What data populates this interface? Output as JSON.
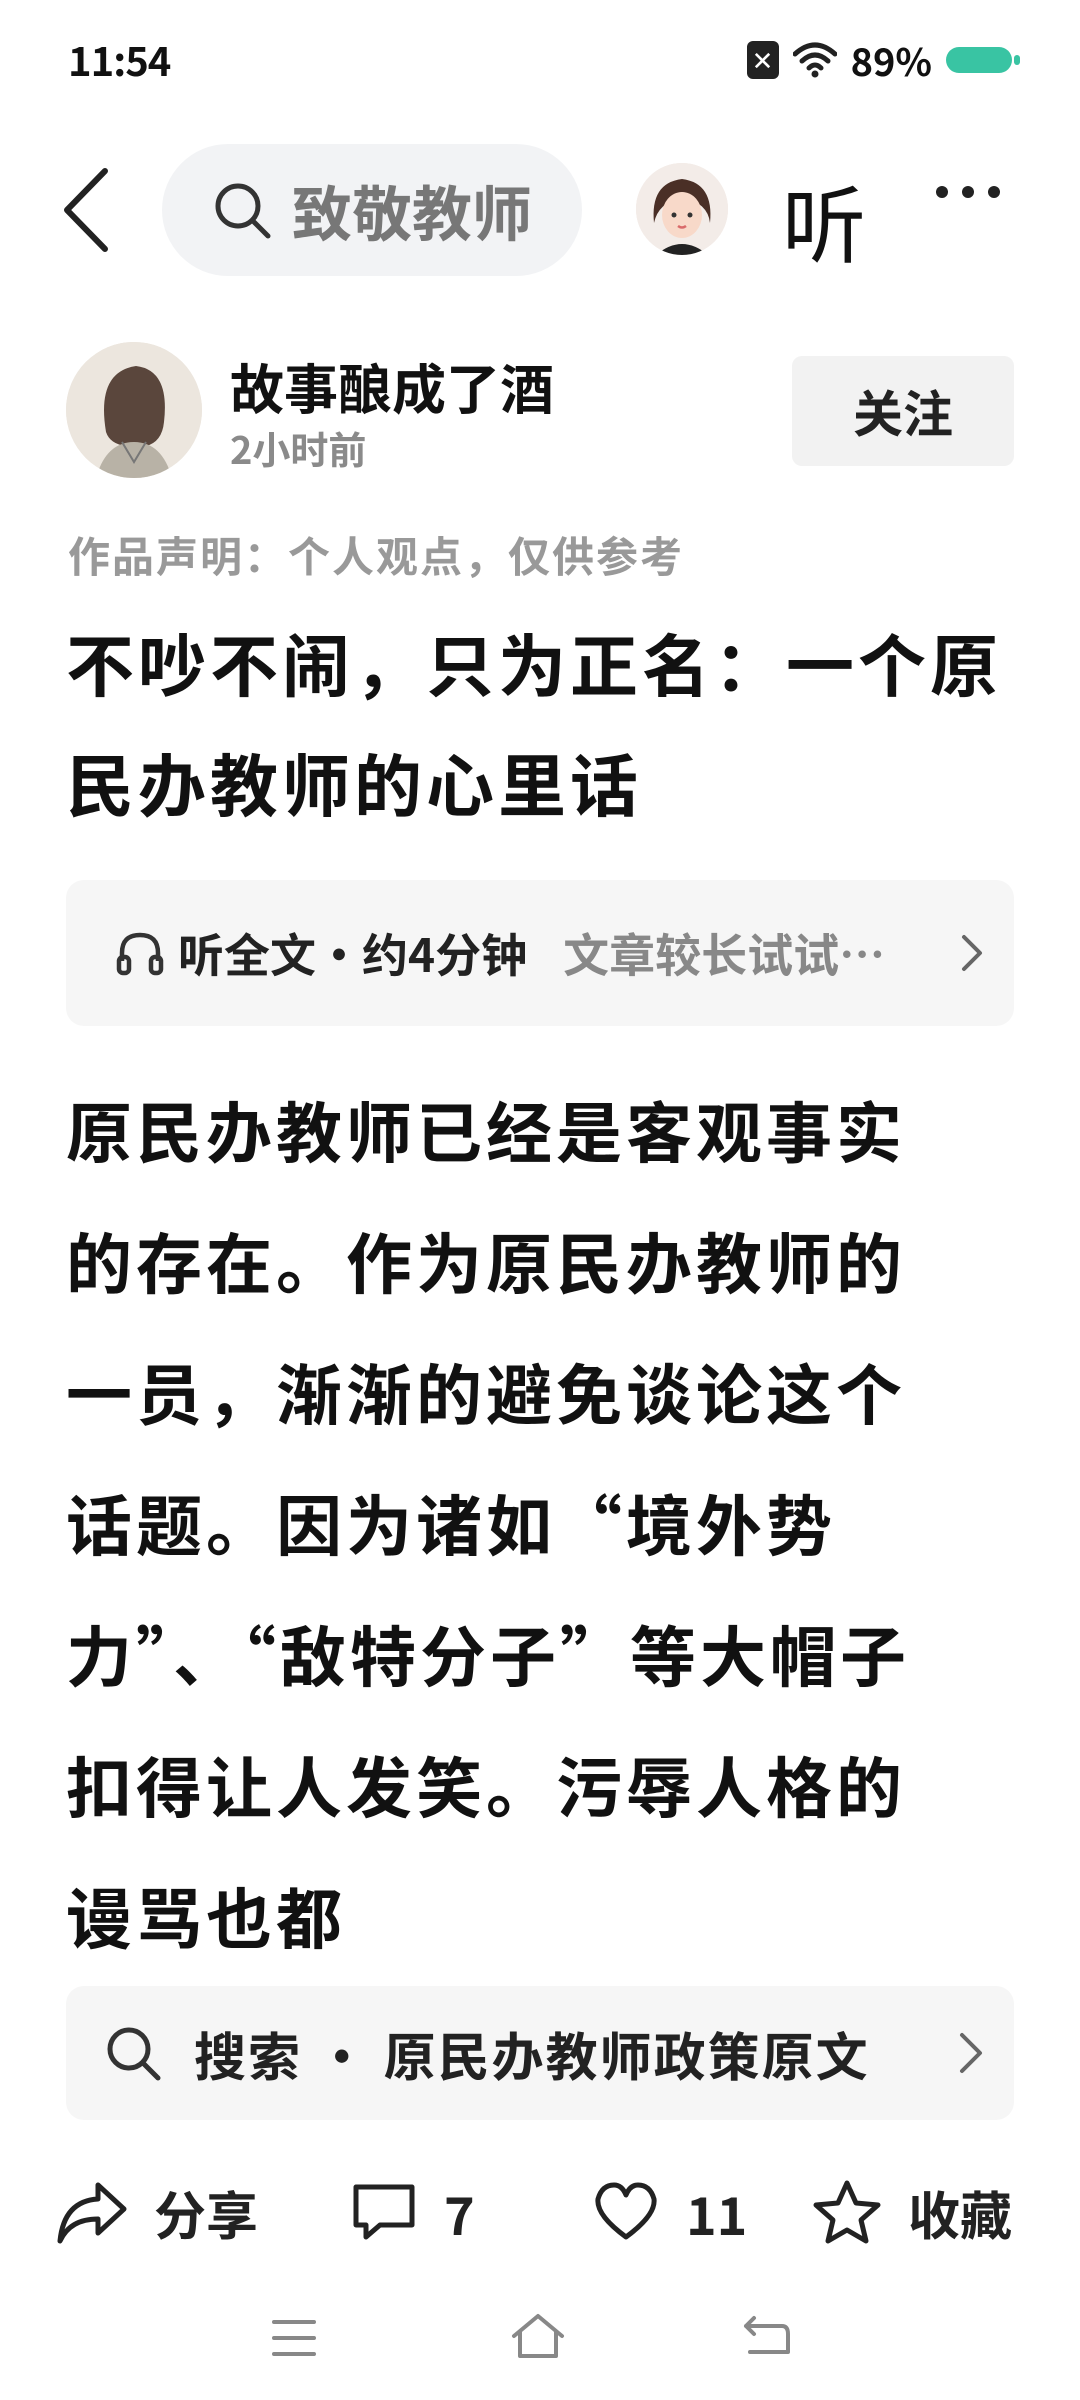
{
  "status_bar": {
    "time": "11:54",
    "battery": "89%"
  },
  "nav": {
    "search_text": "致敬教师",
    "listen_label": "听"
  },
  "author": {
    "name": "故事酿成了酒",
    "time": "2小时前",
    "follow_label": "关注"
  },
  "disclaimer": "作品声明：个人观点，仅供参考",
  "title": "不吵不闹，只为正名：一个原民办教师的心里话",
  "audio": {
    "label": "听全文·约4分钟",
    "hint": "文章较长试试听全文"
  },
  "body": "原民办教师已经是客观事实的存在。作为原民办教师的一员，渐渐的避免谈论这个话题。因为诸如“境外势力”、“敌特分子”等大帽子扣得让人发笑。污辱人格的谩骂也都",
  "related_search": {
    "label": "搜索 · 原民办教师政策原文"
  },
  "actions": {
    "share": "分享",
    "comments": "7",
    "likes": "11",
    "favorite": "收藏"
  }
}
